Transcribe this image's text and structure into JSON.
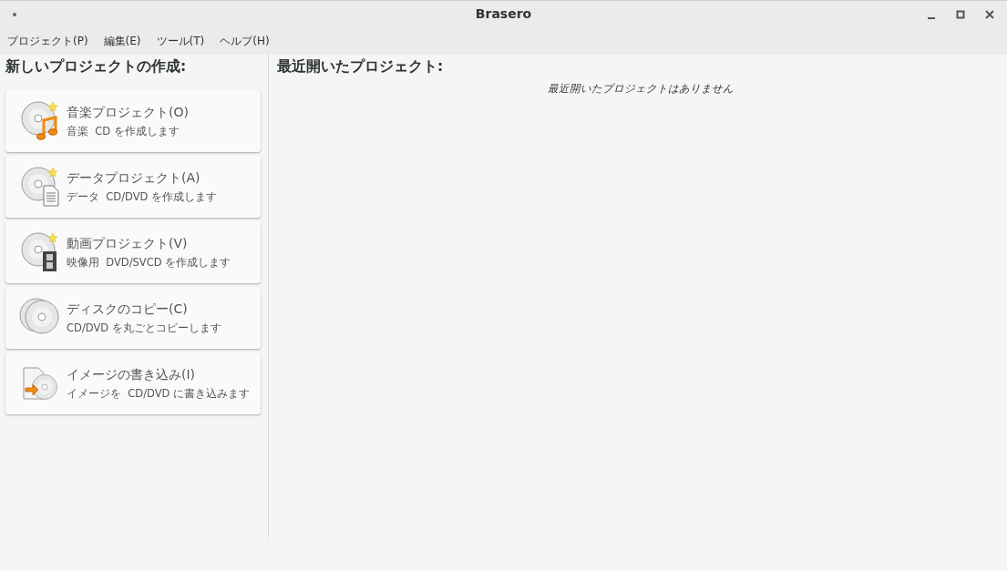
{
  "window": {
    "title": "Brasero"
  },
  "menu": [
    "プロジェクト(P)",
    "編集(E)",
    "ツール(T)",
    "ヘルプ(H)"
  ],
  "new_project": {
    "heading": "新しいプロジェクトの作成:",
    "items": [
      {
        "kind": "audio",
        "title": "音楽プロジェクト(O)",
        "description": "音楽  CD を作成します"
      },
      {
        "kind": "data",
        "title": "データプロジェクト(A)",
        "description": "データ  CD/DVD を作成します"
      },
      {
        "kind": "video",
        "title": "動画プロジェクト(V)",
        "description": "映像用  DVD/SVCD を作成します"
      },
      {
        "kind": "copy",
        "title": "ディスクのコピー(C)",
        "description": "CD/DVD を丸ごとコピーします"
      },
      {
        "kind": "image",
        "title": "イメージの書き込み(I)",
        "description": "イメージを  CD/DVD に書き込みます"
      }
    ]
  },
  "recent": {
    "heading": "最近開いたプロジェクト:",
    "empty_message": "最近開いたプロジェクトはありません"
  }
}
